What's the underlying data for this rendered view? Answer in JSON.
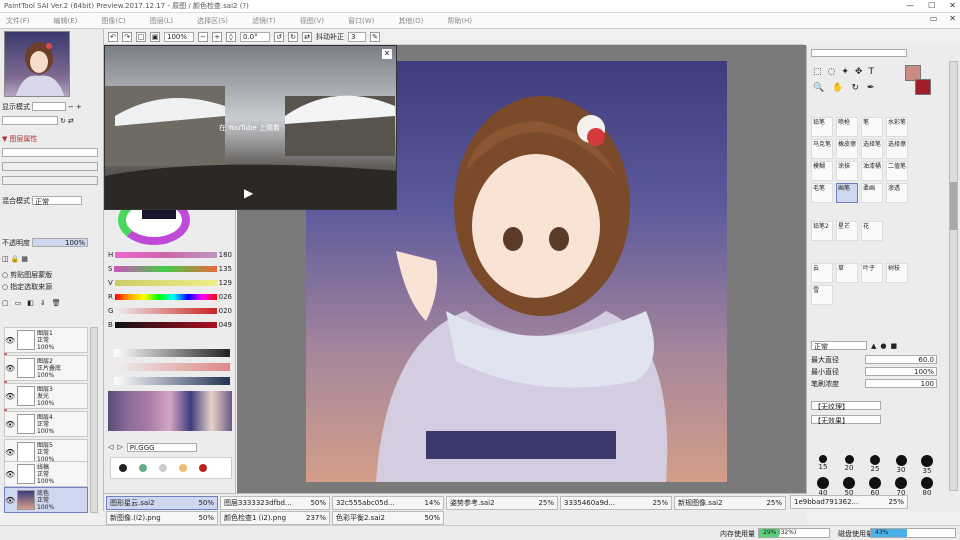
{
  "titlebar": {
    "title": "PaintTool SAI Ver.2 (64bit) Preview.2017.12.17 - 原图 / 颜色检查.sai2 (?)",
    "min": "—",
    "max": "☐",
    "close": "✕"
  },
  "menu": {
    "items": [
      "文件(F)",
      "编辑(E)",
      "图像(C)",
      "图层(L)",
      "选择区(S)",
      "滤镜(T)",
      "视图(V)",
      "窗口(W)",
      "其他(O)",
      "帮助(H)"
    ]
  },
  "left": {
    "mode_label": "显示模式",
    "opacity_label": "不透明度",
    "opacity_value": "100%",
    "blend_label": "混合模式",
    "blend_value": "正常",
    "chk1": "剪贴图层蒙版",
    "chk2": "指定选取来源",
    "layers": [
      {
        "name": "图层1",
        "sub": "正常",
        "op": "100%"
      },
      {
        "name": "图层2",
        "sub": "正片叠底",
        "op": "100%"
      },
      {
        "name": "图层3",
        "sub": "发光",
        "op": "100%"
      },
      {
        "name": "图层4",
        "sub": "正常",
        "op": "100%"
      },
      {
        "name": "图层5",
        "sub": "正常",
        "op": "100%"
      },
      {
        "name": "线稿",
        "sub": "正常",
        "op": "100%"
      },
      {
        "name": "底色",
        "sub": "正常",
        "op": "100%"
      }
    ]
  },
  "color": {
    "rows": [
      {
        "label": "H",
        "value": "180"
      },
      {
        "label": "S",
        "value": "135"
      },
      {
        "label": "V",
        "value": "129"
      },
      {
        "label": "R",
        "value": "026"
      },
      {
        "label": "G",
        "value": "020"
      },
      {
        "label": "B",
        "value": "049"
      }
    ],
    "preset_label": "PI.GGG"
  },
  "video": {
    "caption": "在 YouTube 上观看",
    "play": "▶",
    "close": "✕"
  },
  "toolbar": {
    "zoom": "100%",
    "angle": "0.0°",
    "mode": "抖动补正",
    "mode_value": "3"
  },
  "right": {
    "tools": [
      "铅笔",
      "喷枪",
      "笔",
      "水彩笔",
      "马克笔",
      "橡皮擦",
      "选择笔",
      "选择擦",
      "模糊",
      "涂抹",
      "油漆桶",
      "二值笔",
      "毛笔",
      "画笔",
      "柔画",
      "渗透",
      "铅笔2",
      "星芒",
      "花",
      "云",
      "草",
      "叶子",
      "树枝",
      "雪"
    ],
    "blend": "正常",
    "size_label": "最大直径",
    "size_value": "60.0",
    "min_label": "最小直径",
    "min_value": "100%",
    "density_label": "笔刷浓度",
    "density_value": "100",
    "shape_label": "【无纹理】",
    "tex_label": "【无效果】",
    "sizes": [
      "15",
      "20",
      "25",
      "30",
      "35",
      "40",
      "50",
      "60",
      "70",
      "80"
    ]
  },
  "tabs": [
    {
      "name": "图形星云.sai2",
      "zoom": "50%",
      "active": true
    },
    {
      "name": "图层3333323dfbd...",
      "zoom": "50%"
    },
    {
      "name": "32c555abc05d...",
      "zoom": "14%"
    },
    {
      "name": "姿势参考.sai2",
      "zoom": "25%"
    },
    {
      "name": "3335460a9d...",
      "zoom": "25%"
    },
    {
      "name": "新规图像.sai2",
      "zoom": "25%"
    },
    {
      "name": "1e9bbad791362...",
      "zoom": "25%"
    },
    {
      "name": "新图像.(i2).png",
      "zoom": "50%"
    },
    {
      "name": "颜色检查1 (i2).png",
      "zoom": "237%"
    },
    {
      "name": "色彩平衡2.sai2",
      "zoom": "50%"
    }
  ],
  "bottom": {
    "mem_label": "内存使用量",
    "mem_value": "29% (32%)",
    "disk_label": "磁盘使用量",
    "disk_value": "43%"
  },
  "colors": {
    "accent": "#6f80c2",
    "fg_swatch": "#c98a84",
    "bg_swatch": "#a01e2a"
  }
}
